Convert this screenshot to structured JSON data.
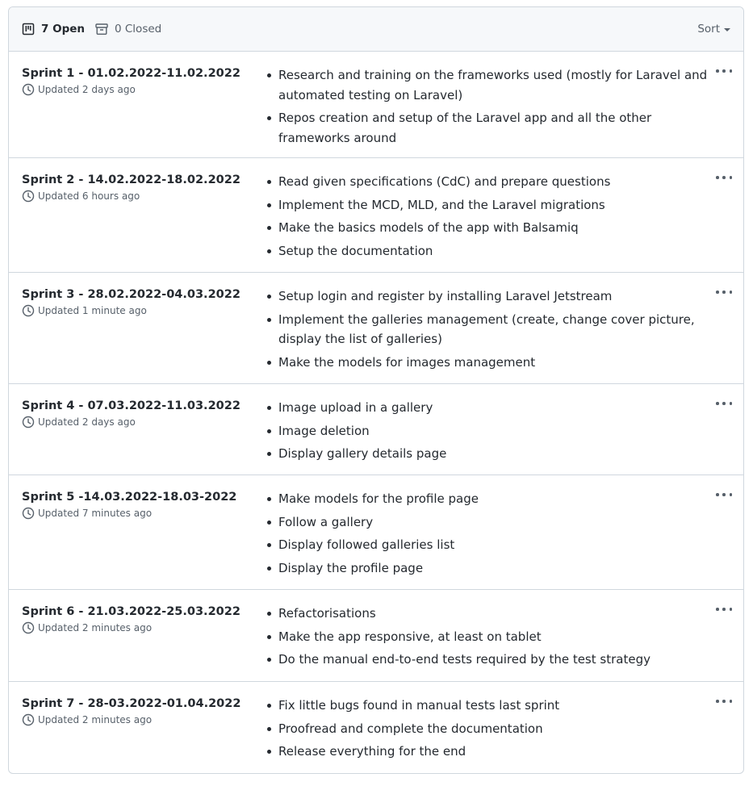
{
  "header": {
    "open_label": "7 Open",
    "closed_label": "0 Closed",
    "sort_label": "Sort"
  },
  "milestones": [
    {
      "title": "Sprint 1 - 01.02.2022-11.02.2022",
      "updated": "Updated 2 days ago",
      "items": [
        "Research and training on the frameworks used (mostly for Laravel and automated testing on Laravel)",
        "Repos creation and setup of the Laravel app and all the other frameworks around"
      ]
    },
    {
      "title": "Sprint 2 - 14.02.2022-18.02.2022",
      "updated": "Updated 6 hours ago",
      "items": [
        "Read given specifications (CdC) and prepare questions",
        "Implement the MCD, MLD, and the Laravel migrations",
        "Make the basics models of the app with Balsamiq",
        "Setup the documentation"
      ]
    },
    {
      "title": "Sprint 3 - 28.02.2022-04.03.2022",
      "updated": "Updated 1 minute ago",
      "items": [
        "Setup login and register by installing Laravel Jetstream",
        "Implement the galleries management (create, change cover picture, display the list of galleries)",
        "Make the models for images management"
      ]
    },
    {
      "title": "Sprint 4 - 07.03.2022-11.03.2022",
      "updated": "Updated 2 days ago",
      "items": [
        "Image upload in a gallery",
        "Image deletion",
        "Display gallery details page"
      ]
    },
    {
      "title": "Sprint 5 -14.03.2022-18.03-2022",
      "updated": "Updated 7 minutes ago",
      "items": [
        "Make models for the profile page",
        "Follow a gallery",
        "Display followed galleries list",
        "Display the profile page"
      ]
    },
    {
      "title": "Sprint 6 - 21.03.2022-25.03.2022",
      "updated": "Updated 2 minutes ago",
      "items": [
        "Refactorisations",
        "Make the app responsive, at least on tablet",
        "Do the manual end-to-end tests required by the test strategy"
      ]
    },
    {
      "title": "Sprint 7 - 28-03.2022-01.04.2022",
      "updated": "Updated 2 minutes ago",
      "items": [
        "Fix little bugs found in manual tests last sprint",
        "Proofread and complete the documentation",
        "Release everything for the end"
      ]
    }
  ]
}
